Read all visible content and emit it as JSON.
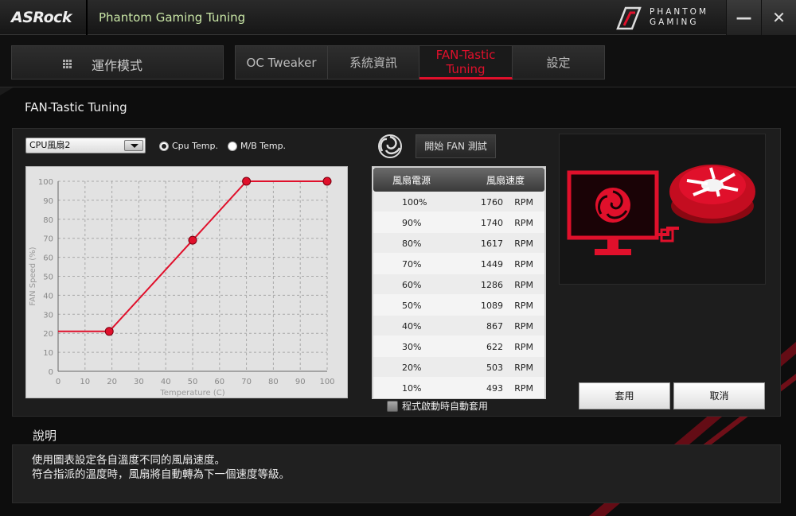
{
  "titlebar": {
    "brand": "ASRock",
    "app_title": "Phantom Gaming Tuning",
    "logo_line1": "PHANTOM",
    "logo_line2": "GAMING",
    "minimize_glyph": "—",
    "close_glyph": "✕"
  },
  "nav": {
    "mode_label": "運作模式",
    "tabs": [
      {
        "label": "OC Tweaker",
        "active": false
      },
      {
        "label": "系統資訊",
        "active": false
      },
      {
        "label": "FAN-Tastic Tuning",
        "active": true
      },
      {
        "label": "設定",
        "active": false
      }
    ]
  },
  "page_title": "FAN-Tastic Tuning",
  "fan_select": {
    "value": "CPU風扇2"
  },
  "temp_source": {
    "options": [
      {
        "label": "Cpu Temp.",
        "checked": true
      },
      {
        "label": "M/B Temp.",
        "checked": false
      }
    ]
  },
  "test_button_label": "開始 FAN 測試",
  "chart_data": {
    "type": "line",
    "xlabel": "Temperature (C)",
    "ylabel": "FAN Speed (%)",
    "xlim": [
      0,
      100
    ],
    "ylim": [
      0,
      100
    ],
    "x_ticks": [
      "0",
      "10",
      "20",
      "30",
      "40",
      "50",
      "60",
      "70",
      "80",
      "90",
      "100"
    ],
    "y_ticks": [
      "0",
      "10",
      "20",
      "30",
      "40",
      "50",
      "60",
      "70",
      "80",
      "90",
      "100"
    ],
    "grid": true,
    "line": {
      "x": [
        0,
        19,
        50,
        70,
        100
      ],
      "y": [
        21,
        21,
        69,
        100,
        100
      ]
    },
    "control_points": [
      {
        "x": 19,
        "y": 21
      },
      {
        "x": 50,
        "y": 69
      },
      {
        "x": 70,
        "y": 100
      },
      {
        "x": 100,
        "y": 100
      }
    ],
    "color": "#e0102b"
  },
  "fan_table": {
    "header_power": "風扇電源",
    "header_speed": "風扇速度",
    "unit": "RPM",
    "rows": [
      {
        "pct": "100%",
        "rpm": "1760"
      },
      {
        "pct": "90%",
        "rpm": "1740"
      },
      {
        "pct": "80%",
        "rpm": "1617"
      },
      {
        "pct": "70%",
        "rpm": "1449"
      },
      {
        "pct": "60%",
        "rpm": "1286"
      },
      {
        "pct": "50%",
        "rpm": "1089"
      },
      {
        "pct": "40%",
        "rpm": "867"
      },
      {
        "pct": "30%",
        "rpm": "622"
      },
      {
        "pct": "20%",
        "rpm": "503"
      },
      {
        "pct": "10%",
        "rpm": "493"
      }
    ]
  },
  "auto_apply": {
    "label": "程式啟動時自動套用",
    "checked": false
  },
  "buttons": {
    "apply": "套用",
    "cancel": "取消"
  },
  "description": {
    "title": "說明",
    "line1": "使用圖表設定各自溫度不同的風扇速度。",
    "line2": "符合指派的溫度時，風扇將自動轉為下一個速度等級。"
  },
  "colors": {
    "accent": "#e0102b",
    "app_title": "#c9e6a6"
  }
}
